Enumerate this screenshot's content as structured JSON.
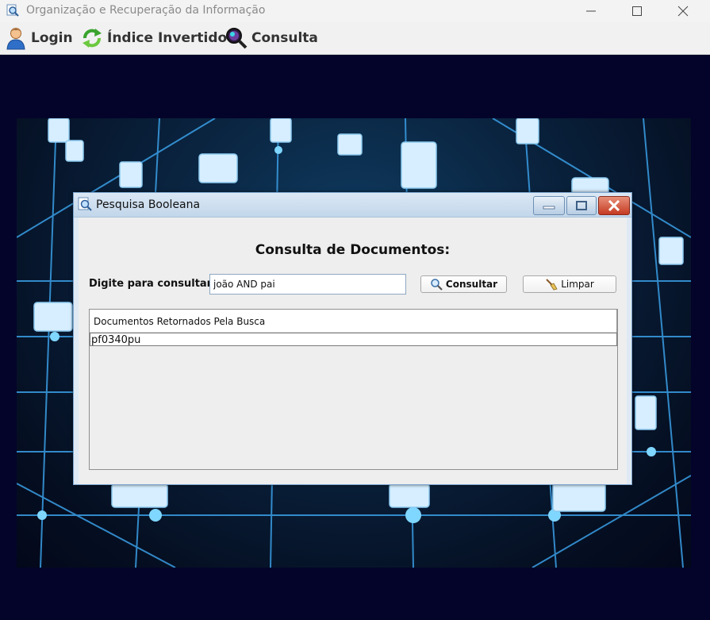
{
  "window": {
    "title": "Organização e Recuperação da Informação"
  },
  "menu": {
    "items": [
      {
        "label": "Login",
        "icon": "user-icon"
      },
      {
        "label": "Índice Invertido",
        "icon": "refresh-icon"
      },
      {
        "label": "Consulta",
        "icon": "magnifier-icon"
      }
    ]
  },
  "dialog": {
    "title": "Pesquisa Booleana",
    "heading": "Consulta de Documentos:",
    "search_label": "Digite para consultar:",
    "search_value": "joão AND pai",
    "consultar_label": "Consultar",
    "limpar_label": "Limpar",
    "results": {
      "column_header": "Documentos Retornados Pela Busca",
      "rows": [
        "pf0340pu"
      ]
    }
  },
  "colors": {
    "desktop_bg": "#04042a",
    "titlebar_bg": "#f3f3f3",
    "dialog_titlebar": "#c2d6ea",
    "close_button": "#c53a22"
  }
}
